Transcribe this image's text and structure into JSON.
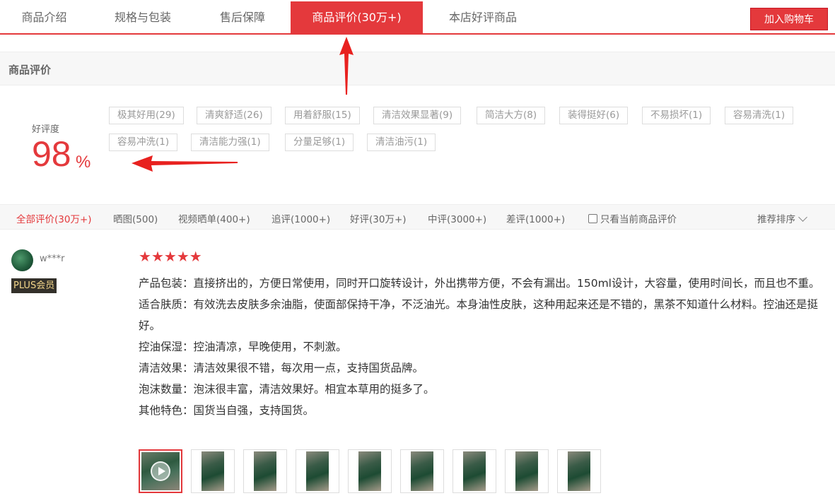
{
  "tabs": [
    {
      "label": "商品介绍",
      "active": false
    },
    {
      "label": "规格与包装",
      "active": false
    },
    {
      "label": "售后保障",
      "active": false
    },
    {
      "label": "商品评价(30万+)",
      "active": true
    },
    {
      "label": "本店好评商品",
      "active": false
    }
  ],
  "cart_button": "加入购物车",
  "section_title": "商品评价",
  "rate": {
    "label": "好评度",
    "value": "98",
    "unit": "%"
  },
  "tags": [
    "极其好用(29)",
    "清爽舒适(26)",
    "用着舒服(15)",
    "清洁效果显著(9)",
    "简洁大方(8)",
    "装得挺好(6)",
    "不易损坏(1)",
    "容易清洗(1)",
    "容易冲洗(1)",
    "清洁能力强(1)",
    "分量足够(1)",
    "清洁油污(1)"
  ],
  "filters": [
    {
      "label": "全部评价(30万+)",
      "active": true
    },
    {
      "label": "晒图(500)",
      "active": false
    },
    {
      "label": "视频晒单(400+)",
      "active": false
    },
    {
      "label": "追评(1000+)",
      "active": false
    },
    {
      "label": "好评(30万+)",
      "active": false
    },
    {
      "label": "中评(3000+)",
      "active": false
    },
    {
      "label": "差评(1000+)",
      "active": false
    }
  ],
  "only_current_label": "只看当前商品评价",
  "only_current_checked": false,
  "sort_label": "推荐排序",
  "review": {
    "username": "w***r",
    "badge": "PLUS会员",
    "stars": 5,
    "lines": [
      "产品包装：直接挤出的，方便日常使用，同时开口旋转设计，外出携带方便，不会有漏出。150ml设计，大容量，使用时间长，而且也不重。",
      "适合肤质：有效洗去皮肤多余油脂，使面部保持干净，不泛油光。本身油性皮肤，这种用起来还是不错的，黑茶不知道什么材料。控油还是挺好。",
      "控油保湿：控油清凉，早晚使用，不刺激。",
      "清洁效果：清洁效果很不错，每次用一点，支持国货品牌。",
      "泡沫数量：泡沫很丰富，清洁效果好。相宜本草用的挺多了。",
      "其他特色：国货当自强，支持国货。"
    ],
    "thumbnail_count": 9
  },
  "colors": {
    "accent": "#e4393c",
    "badge_bg": "#33302a",
    "badge_text": "#f4d68a"
  }
}
